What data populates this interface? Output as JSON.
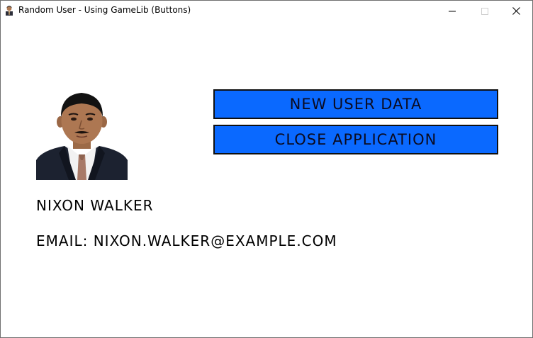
{
  "window": {
    "title": "Random User - Using GameLib (Buttons)",
    "app_icon": "person-icon",
    "controls": [
      "minimize-icon",
      "maximize-icon",
      "close-icon"
    ]
  },
  "buttons": {
    "new_user": "NEW USER DATA",
    "close_app": "CLOSE APPLICATION"
  },
  "user": {
    "name": "NIXON WALKER",
    "email_line": "EMAIL: NIXON.WALKER@EXAMPLE.COM"
  },
  "colors": {
    "button_fill": "#0a69ff",
    "button_border": "#101010",
    "background": "#ffffff"
  }
}
